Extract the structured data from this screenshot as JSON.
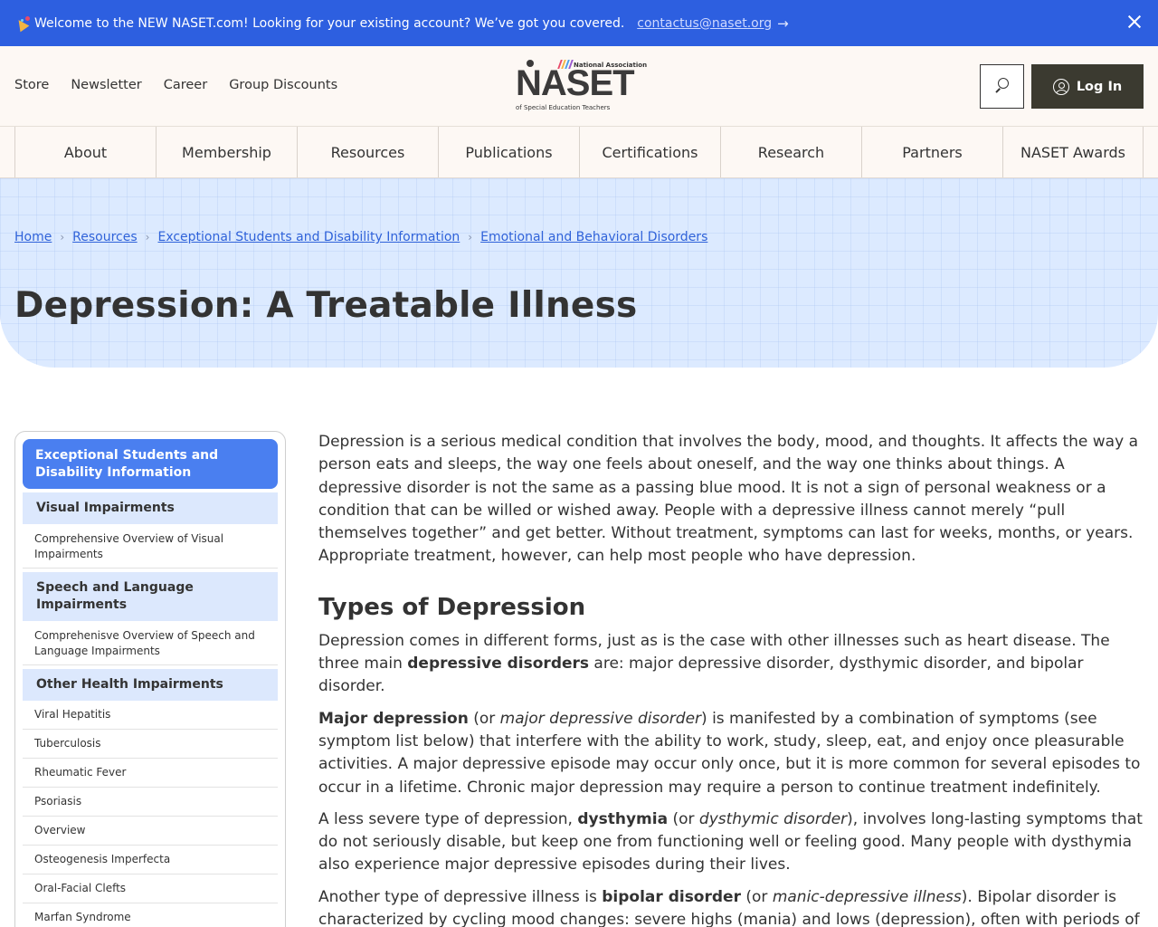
{
  "announcement": {
    "message": "Welcome to the NEW NASET.com! Looking for your existing account? We’ve got you covered.",
    "email": "contactus@naset.org",
    "arrow": "→"
  },
  "header": {
    "utility_links": [
      "Store",
      "Newsletter",
      "Career",
      "Group Discounts"
    ],
    "logo": {
      "top_text": "National Association",
      "name": "NASET",
      "bottom_text": "of Special Education Teachers"
    },
    "login_label": "Log In"
  },
  "nav": {
    "items": [
      "About",
      "Membership",
      "Resources",
      "Publications",
      "Certifications",
      "Research",
      "Partners",
      "NASET Awards"
    ]
  },
  "breadcrumbs": [
    "Home",
    "Resources",
    "Exceptional Students and Disability Information",
    "Emotional and Behavioral Disorders"
  ],
  "page_title": "Depression: A Treatable Illness",
  "sidebar": {
    "heading": "Exceptional Students and Disability Information",
    "cat1": "Visual Impairments",
    "cat1_links": [
      "Comprehensive Overview of Visual Impairments"
    ],
    "cat2": "Speech and Language Impairments",
    "cat2_links": [
      "Comprehenisve Overview of Speech and Language Impairments"
    ],
    "cat3": "Other Health Impairments",
    "cat3_links": [
      "Viral Hepatitis",
      "Tuberculosis",
      "Rheumatic Fever",
      "Psoriasis",
      "Overview",
      "Osteogenesis Imperfecta",
      "Oral-Facial Clefts",
      "Marfan Syndrome"
    ]
  },
  "content": {
    "intro": "Depression is a serious medical condition that involves the body, mood, and thoughts. It affects the way a person eats and sleeps, the way one feels about oneself, and the way one thinks about things. A depressive disorder is not the same as a passing blue mood. It is not a sign of personal weakness or a condition that can be willed or wished away. People with a depressive illness cannot merely “pull themselves together” and get better. Without treatment, symptoms can last for weeks, months, or years. Appropriate treatment, however, can help most people who have depression.",
    "h_types": "Types of Depression",
    "p1_a": "Depression comes in different forms, just as is the case with other illnesses such as heart disease. The three main ",
    "p1_b": "depressive disorders",
    "p1_c": " are: major depressive disorder, dysthymic disorder, and bipolar disorder.",
    "p2_a": "Major depression",
    "p2_b": " (or ",
    "p2_c": "major depressive disorder",
    "p2_d": ") is manifested by a combination of symptoms (see symptom list below) that interfere with the ability to work, study, sleep, eat, and enjoy once pleasurable activities. A major depressive episode may occur only once, but it is more common for several episodes to occur in a lifetime. Chronic major depression may require a person to continue treatment indefinitely.",
    "p3_a": "A less severe type of depression, ",
    "p3_b": "dysthymia",
    "p3_c": " (or ",
    "p3_d": "dysthymic disorder",
    "p3_e": "), involves long-lasting symptoms that do not seriously disable, but keep one from functioning well or feeling good. Many people with dysthymia also experience major depressive episodes during their lives.",
    "p4_a": "Another type of depressive illness is ",
    "p4_b": "bipolar disorder",
    "p4_c": " (or ",
    "p4_d": "manic-depressive illness",
    "p4_e": "). Bipolar disorder is characterized by cycling mood changes: severe highs (mania) and lows (depression), often with periods of"
  },
  "colors": {
    "announcement_bg": "#2d5fe0",
    "header_bg": "#fdf8f4",
    "hero_bg": "#dceaff",
    "link": "#2f62d9",
    "sidebar_heading_bg": "#4a7ff0",
    "sidebar_category_bg": "#dce8fd",
    "login_bg": "#3b3a30"
  },
  "icons": [
    "party-popper-icon",
    "arrow-right-icon",
    "close-icon",
    "search-icon",
    "user-icon",
    "chevron-right-icon"
  ]
}
